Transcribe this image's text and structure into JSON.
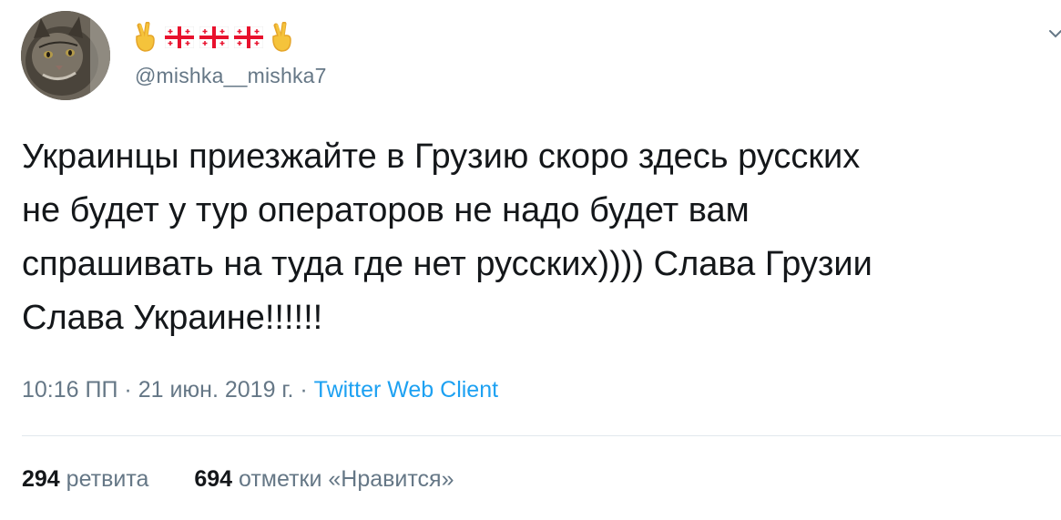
{
  "author": {
    "display_name_icons": [
      "victory-hand",
      "georgia-flag",
      "georgia-flag",
      "georgia-flag",
      "victory-hand"
    ],
    "handle": "@mishka__mishka7"
  },
  "tweet": {
    "text": "Украинцы приезжайте в Грузию скоро здесь русских\nне будет у тур операторов не надо будет вам\nспрашивать на туда где нет русских)))) Слава Грузии\nСлава Украине!!!!!!",
    "time": "10:16 ПП",
    "sep1": "·",
    "date": "21 июн. 2019 г.",
    "sep2": "·",
    "client": "Twitter Web Client"
  },
  "stats": {
    "retweets_count": "294",
    "retweets_label": "ретвита",
    "likes_count": "694",
    "likes_label": "отметки «Нравится»"
  },
  "colors": {
    "text": "#14171a",
    "secondary": "#657786",
    "accent": "#1da1f2",
    "divider": "#e1e8ed"
  }
}
